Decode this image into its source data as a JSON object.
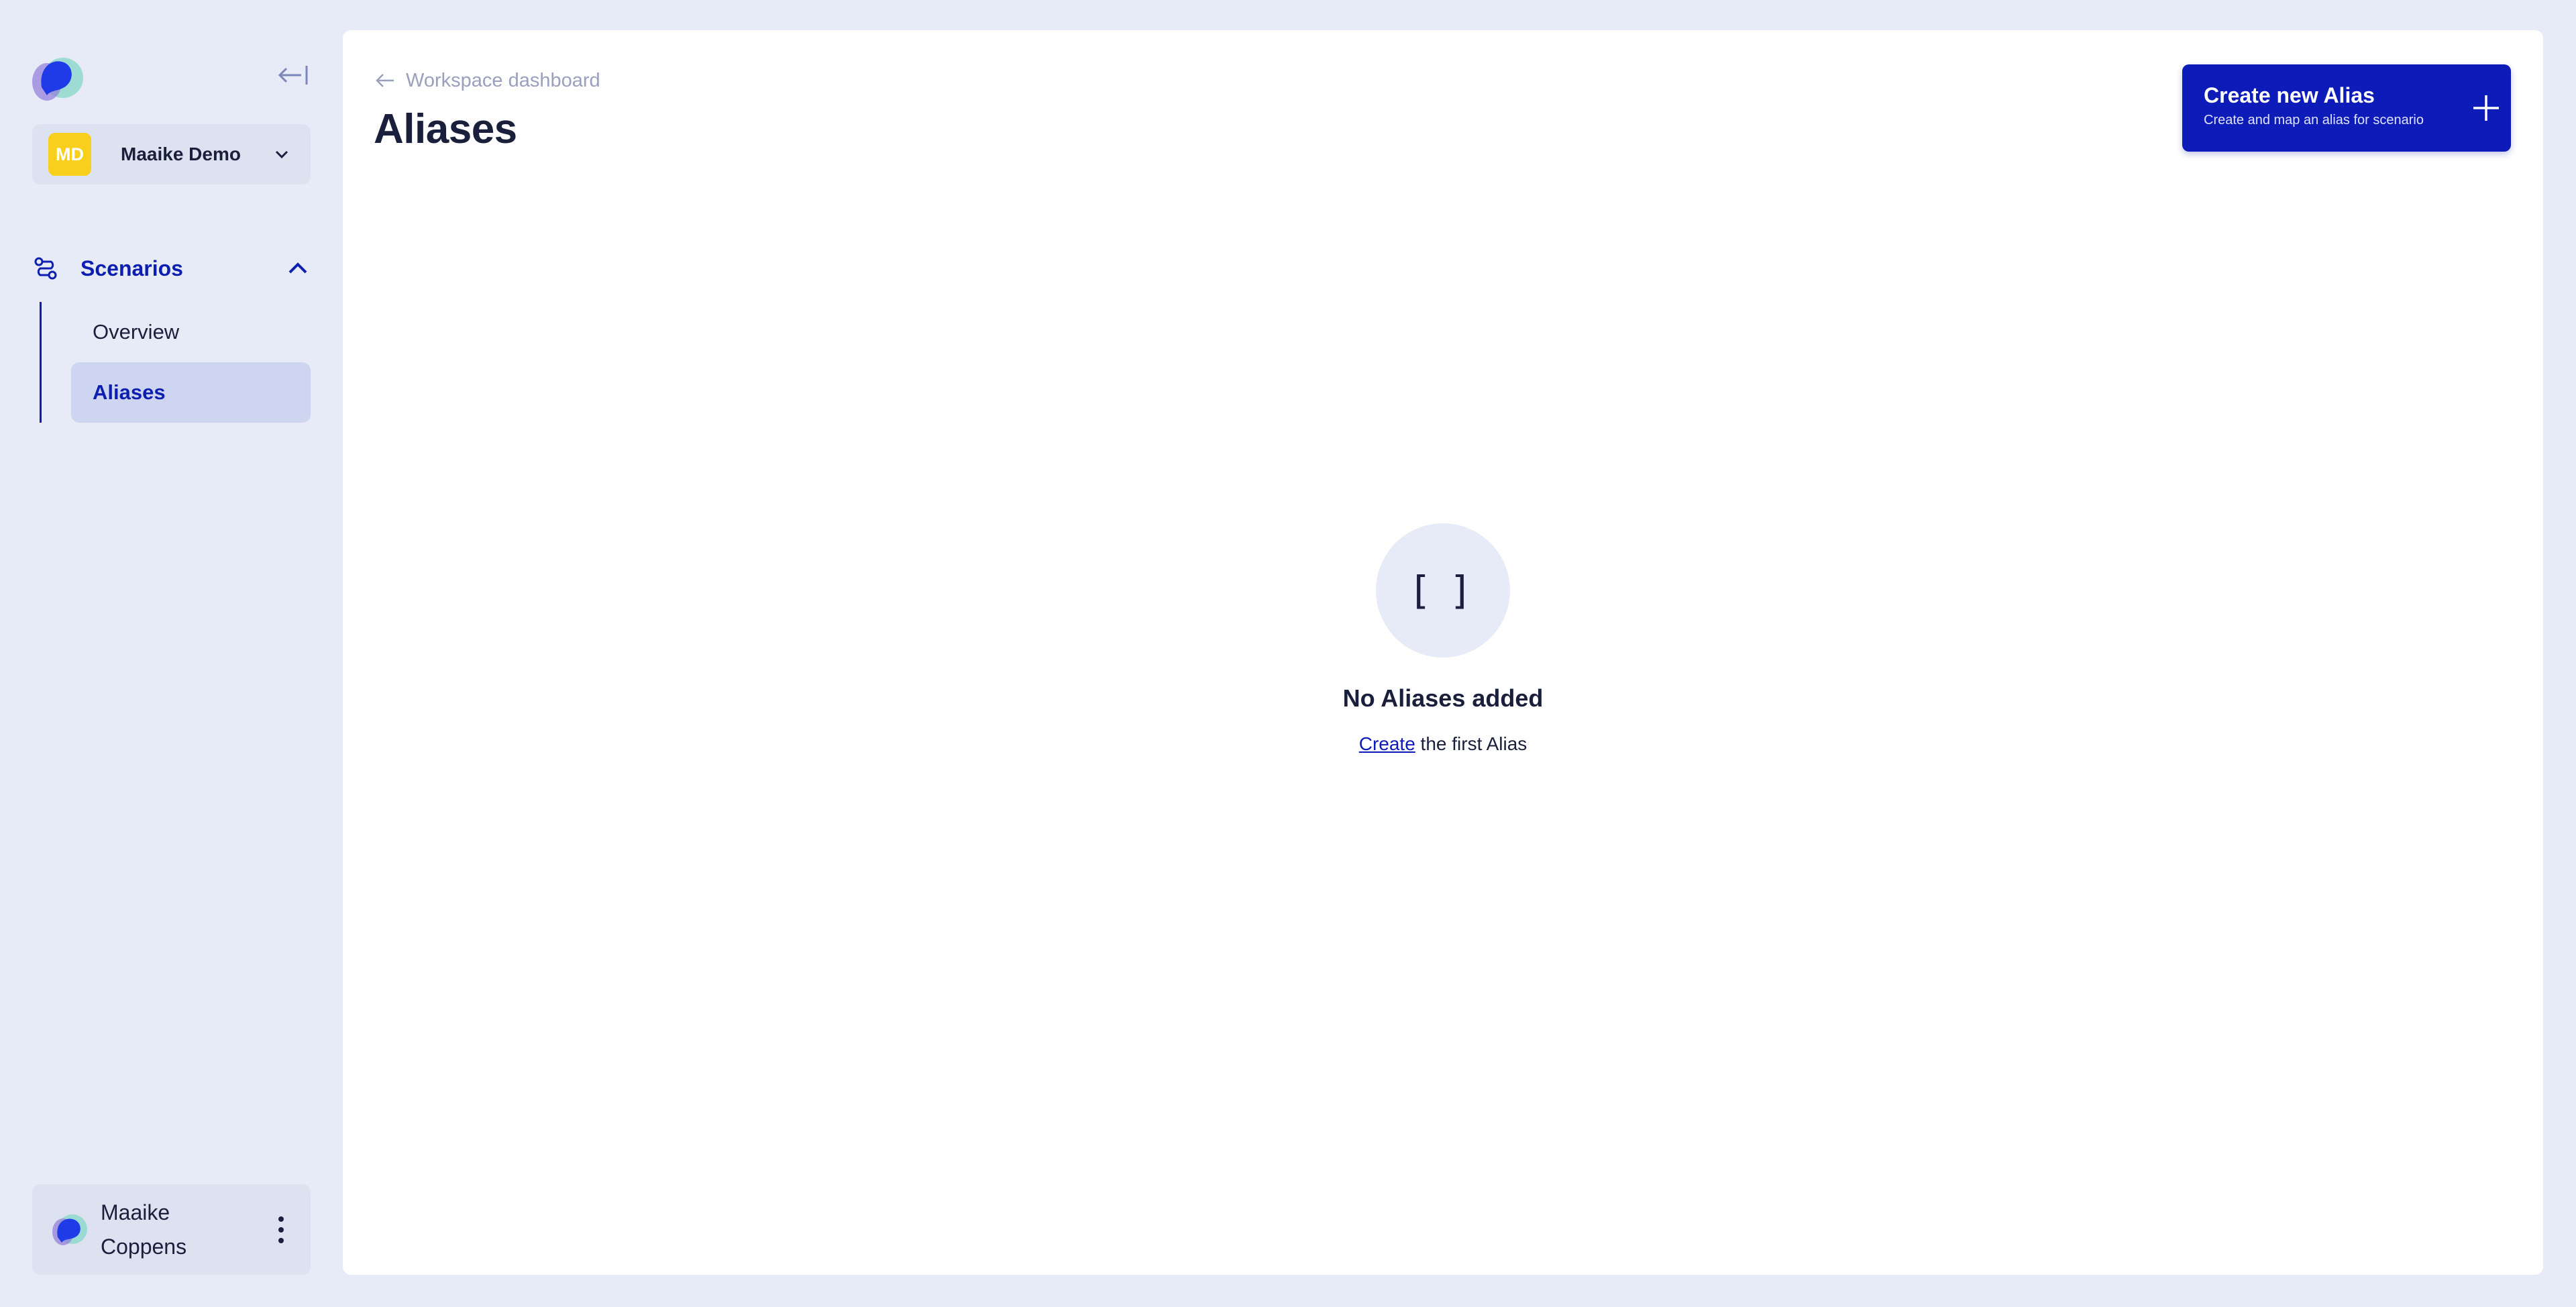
{
  "sidebar": {
    "workspace": {
      "initials": "MD",
      "name": "Maaike Demo",
      "badge_color": "#f8cf1c"
    },
    "section": {
      "label": "Scenarios"
    },
    "items": [
      {
        "label": "Overview",
        "active": false
      },
      {
        "label": "Aliases",
        "active": true
      }
    ],
    "user": {
      "first": "Maaike",
      "last": "Coppens"
    }
  },
  "header": {
    "breadcrumb": "Workspace dashboard",
    "title": "Aliases"
  },
  "create_button": {
    "title": "Create new Alias",
    "subtitle": "Create and map an alias for scenario"
  },
  "empty_state": {
    "icon_text": "[ ]",
    "title": "No Aliases added",
    "link": "Create",
    "rest": " the first Alias"
  },
  "colors": {
    "accent": "#0d1bb8",
    "background": "#e7ebf7",
    "active_item": "#ced5f0"
  }
}
